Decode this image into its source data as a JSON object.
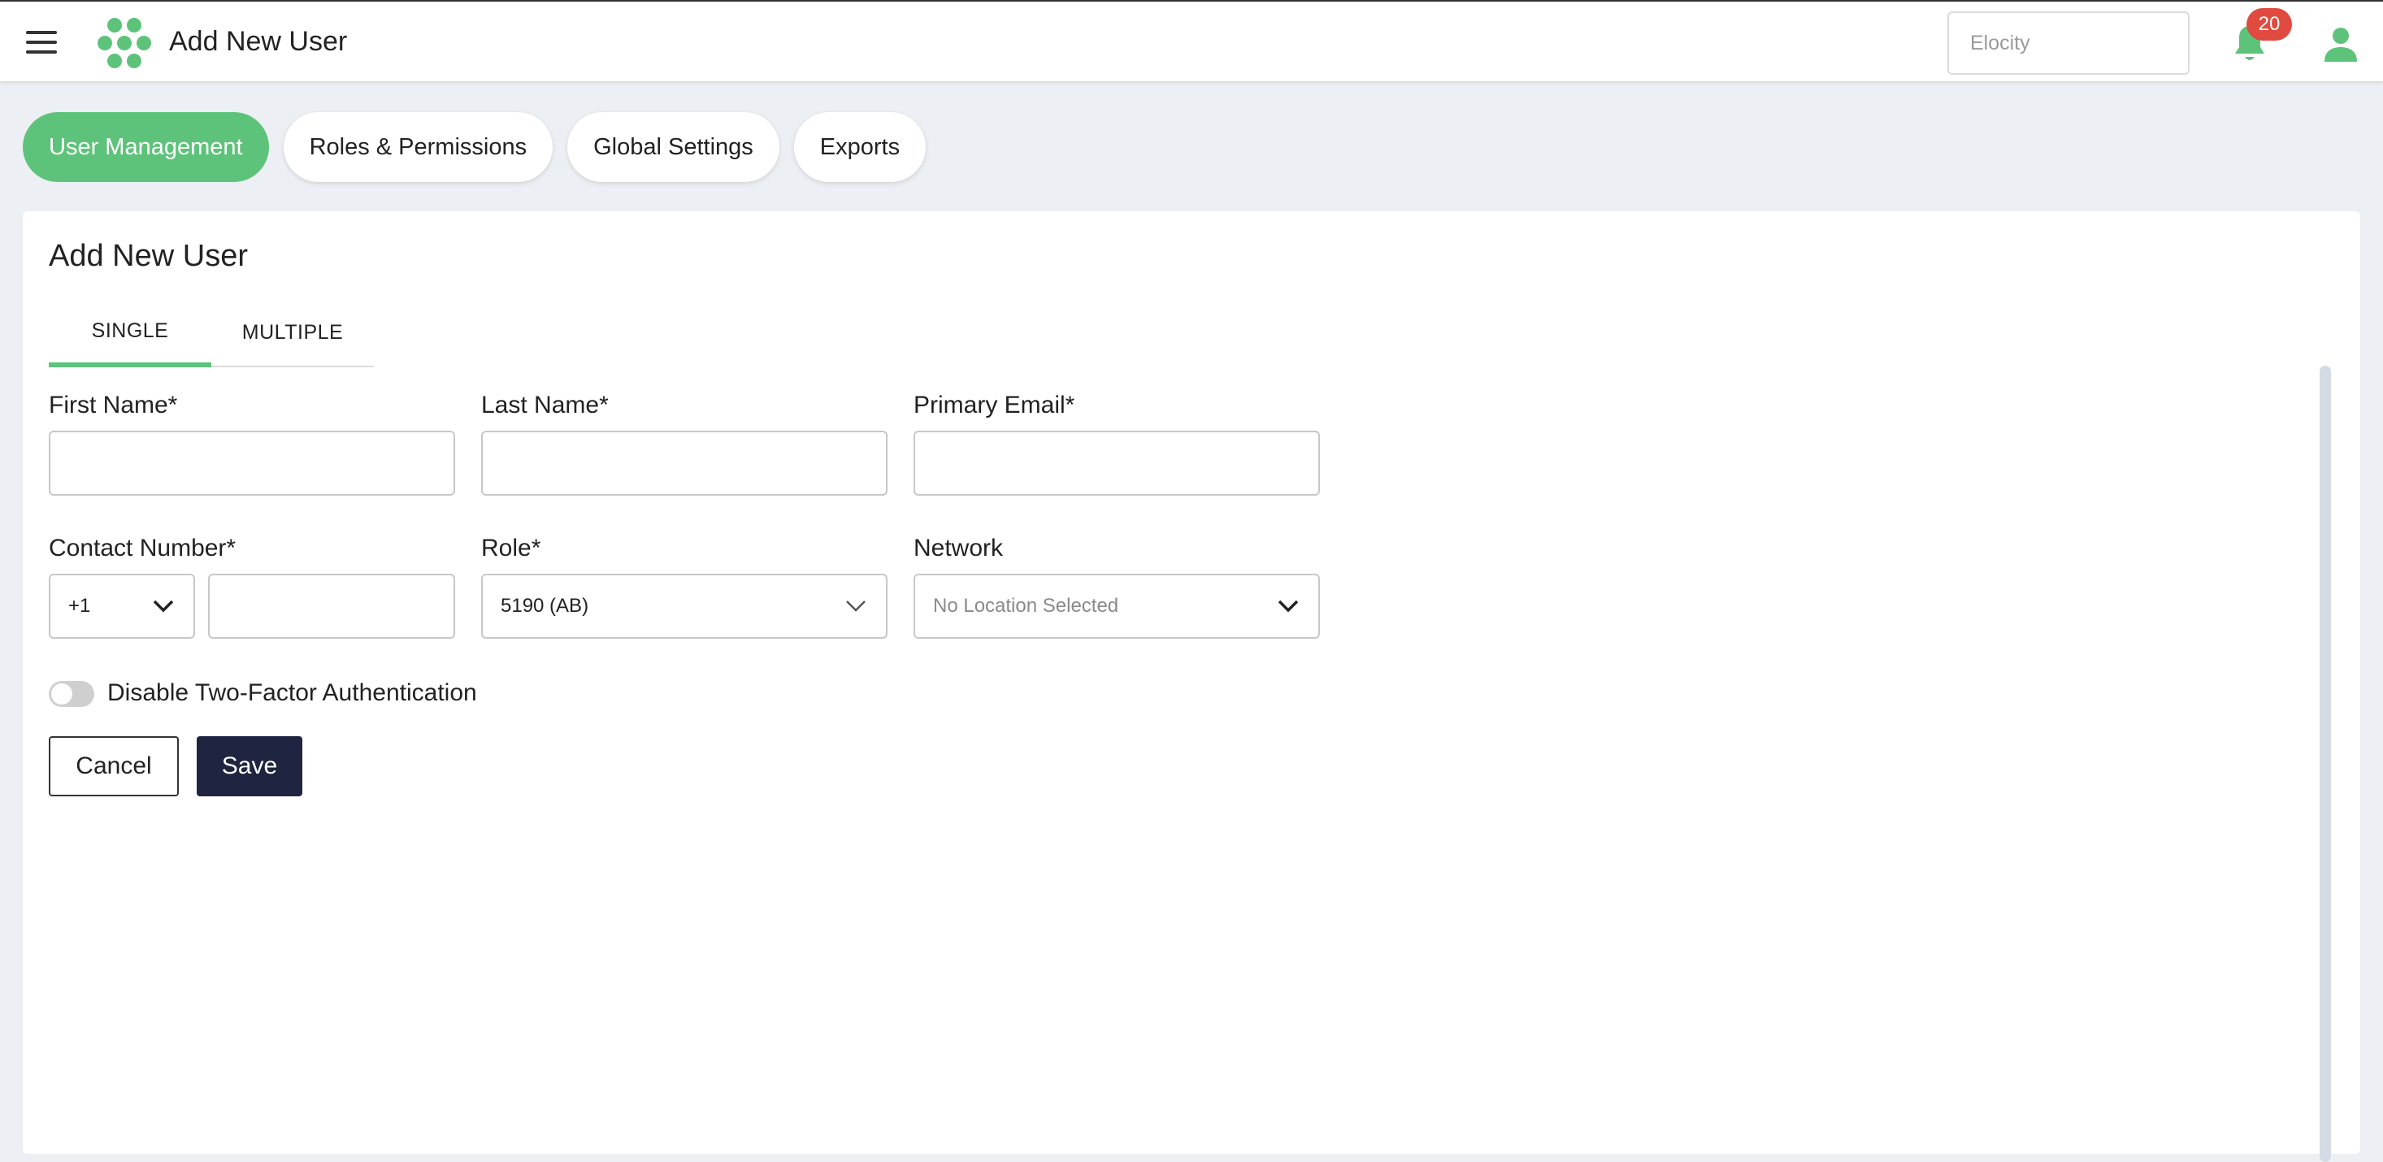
{
  "header": {
    "title": "Add New User",
    "org_placeholder": "Elocity",
    "notification_count": "20",
    "icons": [
      "hamburger-icon",
      "logo-icon",
      "bell-icon",
      "user-icon"
    ]
  },
  "nav": {
    "tabs": [
      {
        "label": "User Management",
        "active": true
      },
      {
        "label": "Roles & Permissions",
        "active": false
      },
      {
        "label": "Global Settings",
        "active": false
      },
      {
        "label": "Exports",
        "active": false
      }
    ]
  },
  "form": {
    "title": "Add New User",
    "subtabs": [
      {
        "label": "SINGLE",
        "active": true
      },
      {
        "label": "MULTIPLE",
        "active": false
      }
    ],
    "first_name": {
      "label": "First Name*",
      "value": ""
    },
    "last_name": {
      "label": "Last Name*",
      "value": ""
    },
    "primary_email": {
      "label": "Primary Email*",
      "value": ""
    },
    "contact_number": {
      "label": "Contact Number*",
      "country_code": "+1",
      "value": ""
    },
    "role": {
      "label": "Role*",
      "value": "5190 (AB)"
    },
    "network": {
      "label": "Network",
      "value": "No Location Selected"
    },
    "two_factor": {
      "label": "Disable Two-Factor Authentication",
      "enabled": false
    },
    "cancel_label": "Cancel",
    "save_label": "Save"
  },
  "colors": {
    "accent": "#5ec37a",
    "primary_button": "#1f2540",
    "badge": "#e04a3f",
    "page_background": "#eceff3"
  }
}
